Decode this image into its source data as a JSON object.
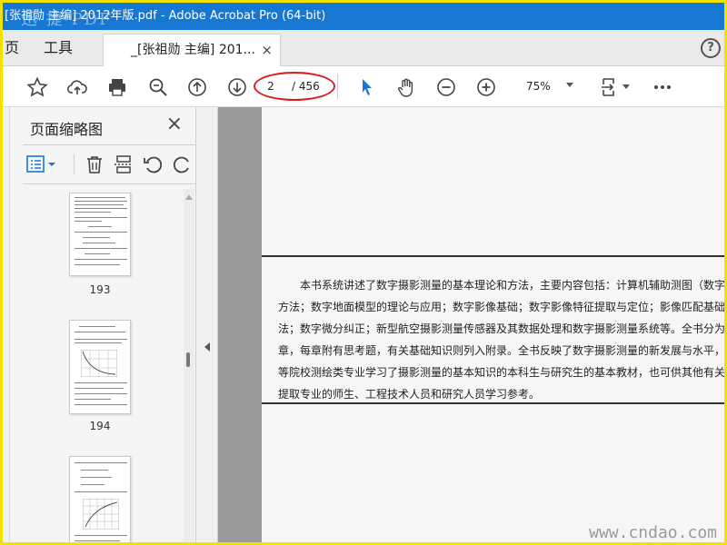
{
  "window": {
    "title": "[张祖勋 主编] 2012年版.pdf - Adobe Acrobat Pro (64-bit)",
    "watermark_top": "迅 捷 PDF"
  },
  "tabs": {
    "home": "页",
    "tools": "工具",
    "doc": "_[张祖勋 主编] 201...",
    "close": "×",
    "help": "?"
  },
  "toolbar": {
    "current_page": "2",
    "total_pages": "/ 456",
    "zoom": "75%"
  },
  "panel": {
    "title": "页面缩略图",
    "close": "×",
    "thumbnails": [
      {
        "label": "193"
      },
      {
        "label": "194"
      },
      {
        "label": ""
      }
    ]
  },
  "document": {
    "abstract_lines": [
      "本书系统讲述了数字摄影测量的基本理论和方法，主要内容包括：计算机辅助测图（数字测图",
      "方法；数字地面模型的理论与应用；数字影像基础；数字影像特征提取与定位；影像匹配基础理论",
      "法；数字微分纠正；新型航空摄影测量传感器及其数据处理和数字摄影测量系统等。全书分为两篇",
      "章，每章附有思考题，有关基础知识则列入附录。全书反映了数字摄影测量的新发展与水平，可作",
      "等院校测绘类专业学习了摄影测量的基本知识的本科生与研究生的基本教材，也可供其他有关影像",
      "提取专业的师生、工程技术人员和研究人员学习参考。"
    ],
    "watermark": "www.cndao.com"
  },
  "colors": {
    "titlebar": "#1778d4",
    "highlight_ellipse": "#d81f1f",
    "frame_border": "#f2e200",
    "select_tool": "#1778d4"
  }
}
